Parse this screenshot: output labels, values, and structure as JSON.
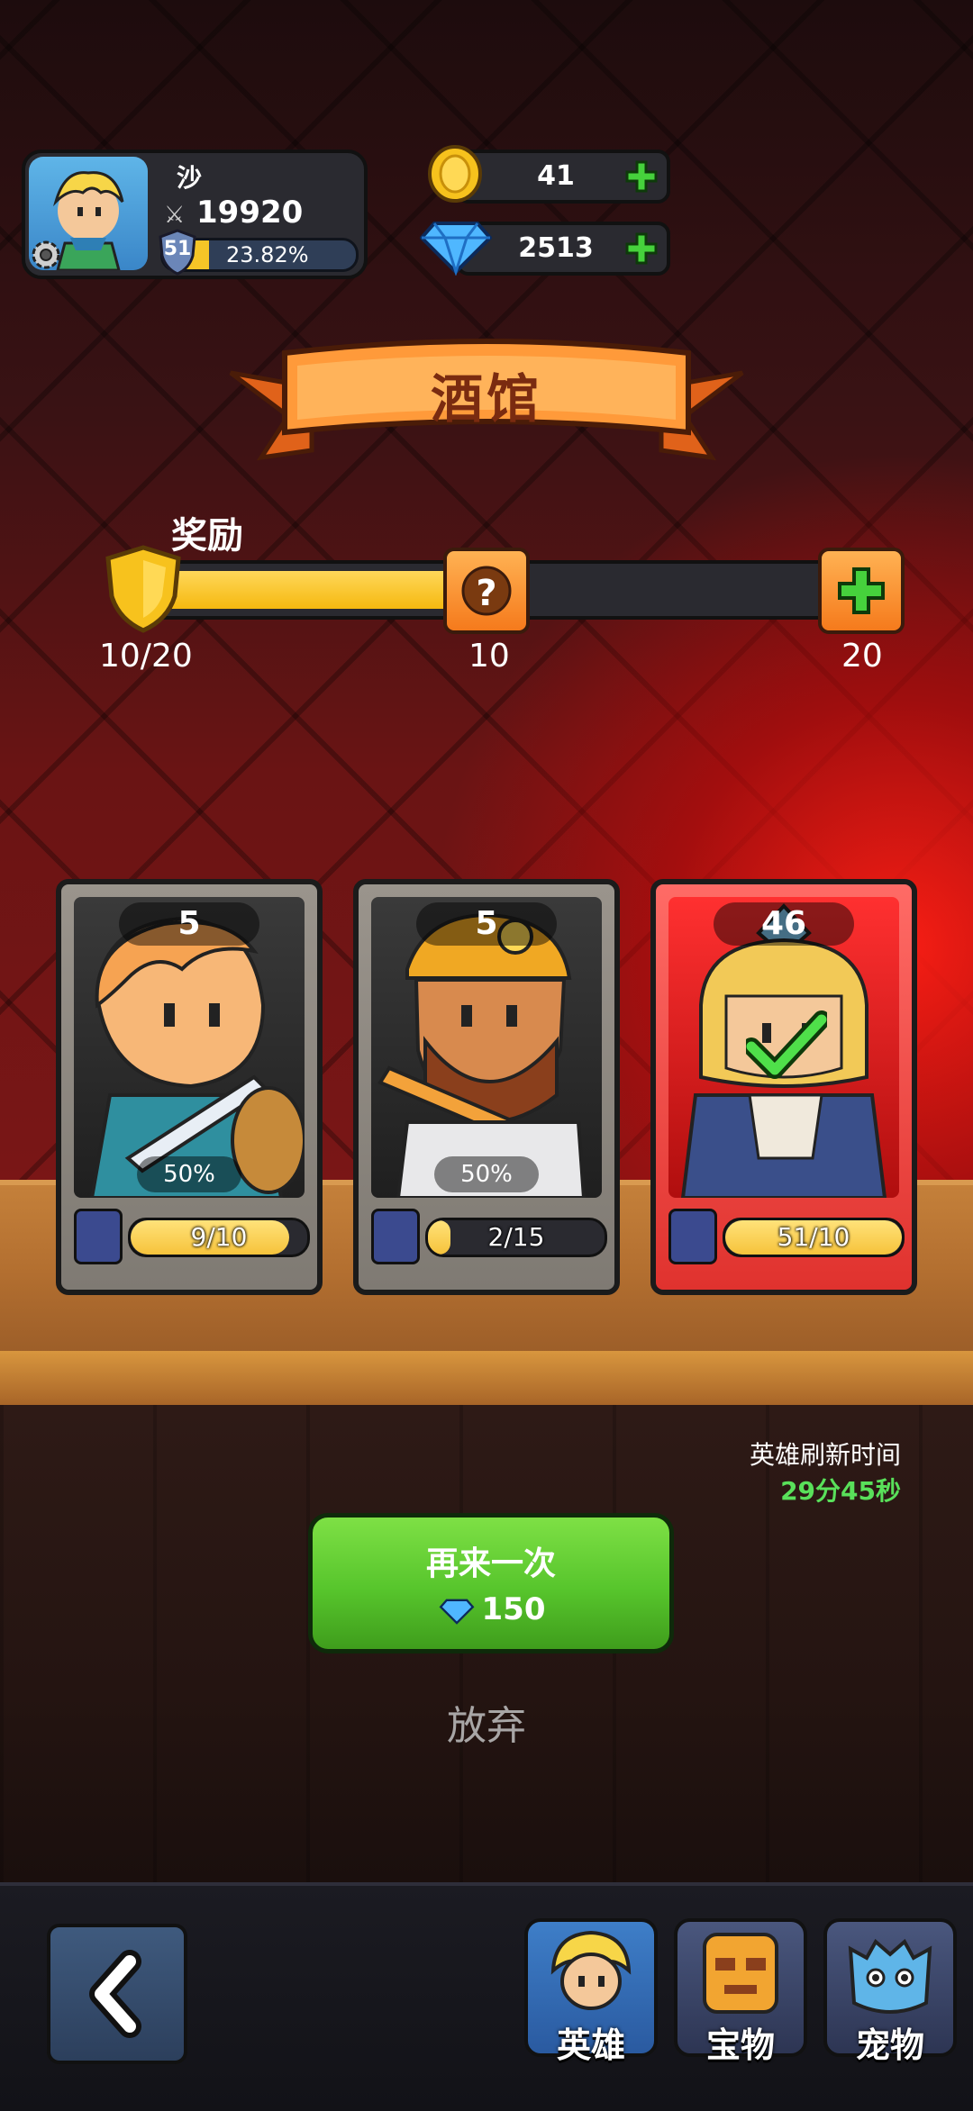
{
  "player": {
    "name": "沙",
    "power": "19920",
    "level": "51",
    "xp_percent": "23.82%",
    "xp_fraction": 0.2382
  },
  "currency": {
    "gold": "41",
    "gems": "2513"
  },
  "title": "酒馆",
  "reward": {
    "label": "奖励",
    "progress_text": "10/20",
    "progress_fraction": 0.5,
    "mid_tick": "10",
    "end_tick": "20"
  },
  "heroes": [
    {
      "level": "5",
      "chance": "50%",
      "shards": "9/10",
      "shard_fraction": 0.9,
      "selected": false
    },
    {
      "level": "5",
      "chance": "50%",
      "shards": "2/15",
      "shard_fraction": 0.13,
      "selected": false
    },
    {
      "level": "46",
      "chance": "",
      "shards": "51/10",
      "shard_fraction": 1.0,
      "selected": true
    }
  ],
  "refresh": {
    "label": "英雄刷新时间",
    "time": "29分45秒"
  },
  "retry": {
    "label": "再来一次",
    "cost": "150"
  },
  "give_up": "放弃",
  "nav": {
    "heroes": "英雄",
    "treasures": "宝物",
    "pets": "宠物"
  },
  "colors": {
    "accent_green": "#59e05a",
    "gold": "#f5c527",
    "banner": "#f57a1c",
    "selected_card": "#e0322e"
  },
  "icons": [
    "settings-gear-icon",
    "sword-icon",
    "shield-level-icon",
    "gold-coin-icon",
    "gem-icon",
    "plus-icon",
    "mystery-chest-icon",
    "hero-cards-icon",
    "checkmark-icon",
    "back-arrow-icon"
  ]
}
